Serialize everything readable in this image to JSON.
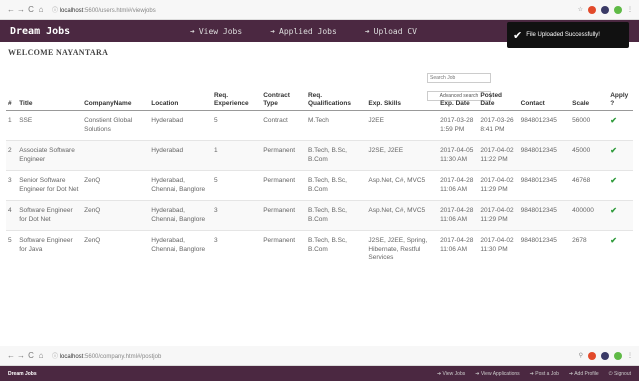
{
  "browser": {
    "url_host": "localhost",
    "url_path": ":5600/users.html#/viewjobs"
  },
  "app": {
    "brand": "Dream Jobs",
    "nav": [
      "View Jobs",
      "Applied Jobs",
      "Upload CV"
    ]
  },
  "toast": {
    "message": "File Uploaded Successfully!"
  },
  "welcome": "Welcome Nayantara",
  "search": {
    "placeholder": "Search Job",
    "advanced_label": "Advanced search"
  },
  "table": {
    "headers": [
      "#",
      "Title",
      "CompanyName",
      "Location",
      "Req. Experience",
      "Contract Type",
      "Req. Qualifications",
      "Exp. Skills",
      "Exp. Date",
      "Posted Date",
      "Contact",
      "Scale",
      "Apply ?"
    ],
    "rows": [
      [
        "1",
        "SSE",
        "Constient Global Solutions",
        "Hyderabad",
        "5",
        "Contract",
        "M.Tech",
        "J2EE",
        "2017-03-28 1:59 PM",
        "2017-03-26 8:41 PM",
        "9848012345",
        "56000"
      ],
      [
        "2",
        "Associate Software Engineer",
        "",
        "Hyderabad",
        "1",
        "Permanent",
        "B.Tech, B.Sc, B.Com",
        "J2SE, J2EE",
        "2017-04-05 11:30 AM",
        "2017-04-02 11:22 PM",
        "9848012345",
        "45000"
      ],
      [
        "3",
        "Senior Software Engineer for Dot Net",
        "ZenQ",
        "Hyderabad, Chennai, Banglore",
        "5",
        "Permanent",
        "B.Tech, B.Sc, B.Com",
        "Asp.Net, C#, MVC5",
        "2017-04-28 11:06 AM",
        "2017-04-02 11:29 PM",
        "9848012345",
        "46768"
      ],
      [
        "4",
        "Software Engineer for Dot Net",
        "ZenQ",
        "Hyderabad, Chennai, Banglore",
        "3",
        "Permanent",
        "B.Tech, B.Sc, B.Com",
        "Asp.Net, C#, MVC5",
        "2017-04-28 11:06 AM",
        "2017-04-02 11:29 PM",
        "9848012345",
        "400000"
      ],
      [
        "5",
        "Software Engineer for Java",
        "ZenQ",
        "Hyderabad, Chennai, Banglore",
        "3",
        "Permanent",
        "B.Tech, B.Sc, B.Com",
        "J2SE, J2EE, Spring, Hibernate, Restful Services",
        "2017-04-28 11:06 AM",
        "2017-04-02 11:30 PM",
        "9848012345",
        "2678"
      ]
    ]
  },
  "browser2": {
    "url_host": "localhost",
    "url_path": ":5600/company.html#/postjob"
  },
  "app2": {
    "brand": "Dream Jobs",
    "nav": [
      "View Jobs",
      "View Applications",
      "Post a Job",
      "Add Profile",
      "Signout"
    ]
  }
}
